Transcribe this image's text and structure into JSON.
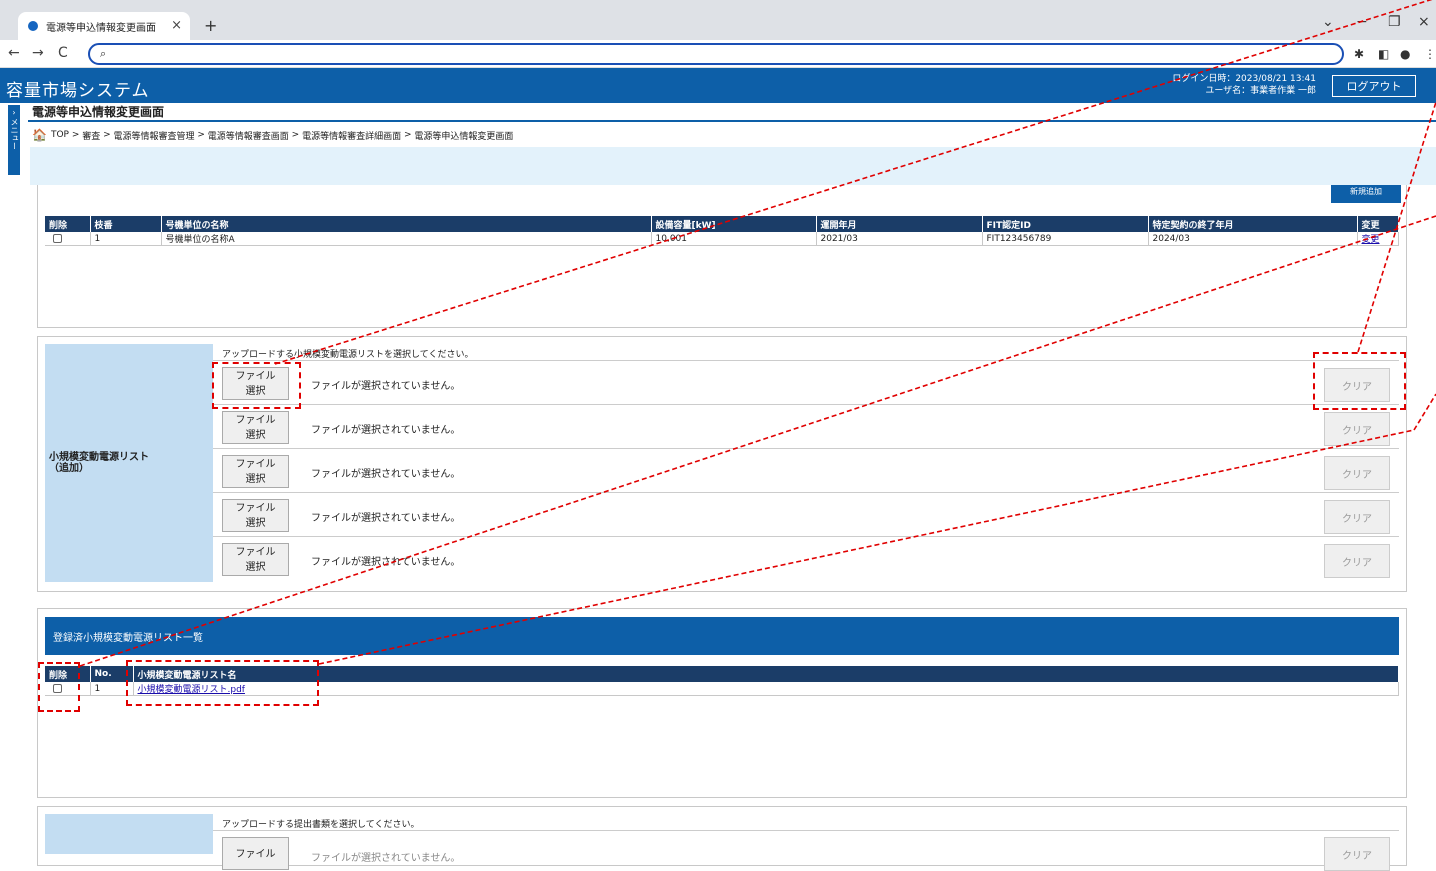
{
  "browser": {
    "tab_title": "電源等申込情報変更画面",
    "address": ""
  },
  "app": {
    "title": "容量市場システム",
    "login_time": "ログイン日時：2023/08/21 13:41",
    "user_name": "ユーザ名：事業者作業 一郎",
    "logout_label": "ログアウト",
    "menu_label": "メニュー"
  },
  "page": {
    "title": "電源等申込情報変更画面",
    "breadcrumb": [
      "TOP",
      "審査",
      "電源等情報審査管理",
      "電源等情報審査画面",
      "電源等情報審査詳細画面",
      "電源等申込情報変更画面"
    ],
    "new_button": "新規追加"
  },
  "unit_table": {
    "headers": [
      "削除",
      "枝番",
      "号機単位の名称",
      "設備容量[kW]",
      "運開年月",
      "FIT認定ID",
      "特定契約の終了年月",
      "変更"
    ],
    "rows": [
      {
        "branch": "1",
        "name": "号機単位の名称A",
        "capacity": "10,001",
        "start": "2021/03",
        "fit_id": "FIT123456789",
        "contract_end": "2024/03",
        "change": "変更"
      }
    ]
  },
  "upload": {
    "label": "小規模変動電源リスト\n（追加）",
    "instruction": "アップロードする小規模変動電源リストを選択してください。",
    "file_button": "ファイル\n選択",
    "no_file": "ファイルが選択されていません。",
    "clear_label": "クリア"
  },
  "registered": {
    "title": "登録済小規模変動電源リスト一覧",
    "headers": [
      "削除",
      "No.",
      "小規模変動電源リスト名"
    ],
    "rows": [
      {
        "no": "1",
        "name": "小規模変動電源リスト.pdf"
      }
    ]
  },
  "upload2": {
    "instruction": "アップロードする提出書類を選択してください。",
    "file_button": "ファイル",
    "no_file": "ファイルが選択されていません。",
    "clear_label": "クリア"
  },
  "colors": {
    "header": "#0d5fa8",
    "table_header": "#1b3d68",
    "label_bg": "#c3ddf2",
    "annotation": "#e00000"
  }
}
